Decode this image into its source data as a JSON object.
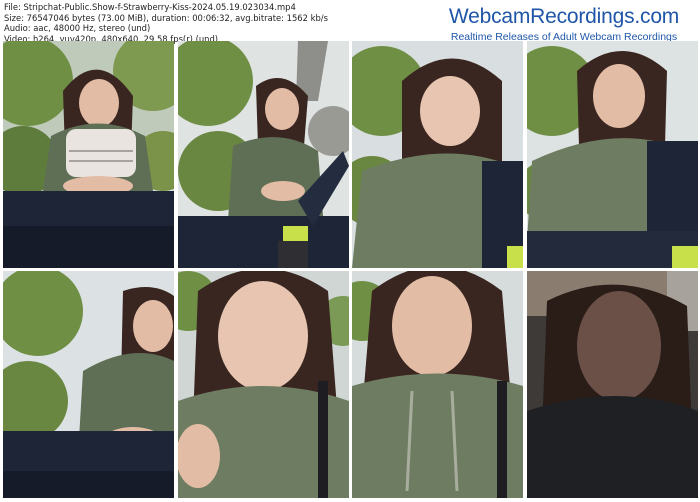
{
  "info": {
    "file": "File: Stripchat-Public.Show-f-Strawberry-Kiss-2024.05.19.023034.mp4",
    "size": "Size: 76547046 bytes (73.00 MiB), duration: 00:06:32, avg.bitrate: 1562 kb/s",
    "audio": "Audio: aac, 48000 Hz, stereo (und)",
    "video": "Video: h264, yuv420p, 480x640, 29.58 fps(r) (und)"
  },
  "brand": {
    "title": "WebcamRecordings.com",
    "subtitle": "Realtime Releases of Adult Webcam Recordings"
  },
  "thumbnails": [
    {
      "scene": "outdoor-seated-hands-on-top"
    },
    {
      "scene": "outdoor-leg-raised"
    },
    {
      "scene": "outdoor-closeup-smiling"
    },
    {
      "scene": "outdoor-closeup-leaning"
    },
    {
      "scene": "outdoor-seated-turned"
    },
    {
      "scene": "outdoor-face-closeup"
    },
    {
      "scene": "outdoor-face-closeup-2"
    },
    {
      "scene": "indoor-dark-closeup"
    }
  ],
  "colors": {
    "brand": "#1f56a8",
    "foliage": "#6f8f45",
    "hoodie": "#5f6f55",
    "hair": "#3a2620"
  }
}
